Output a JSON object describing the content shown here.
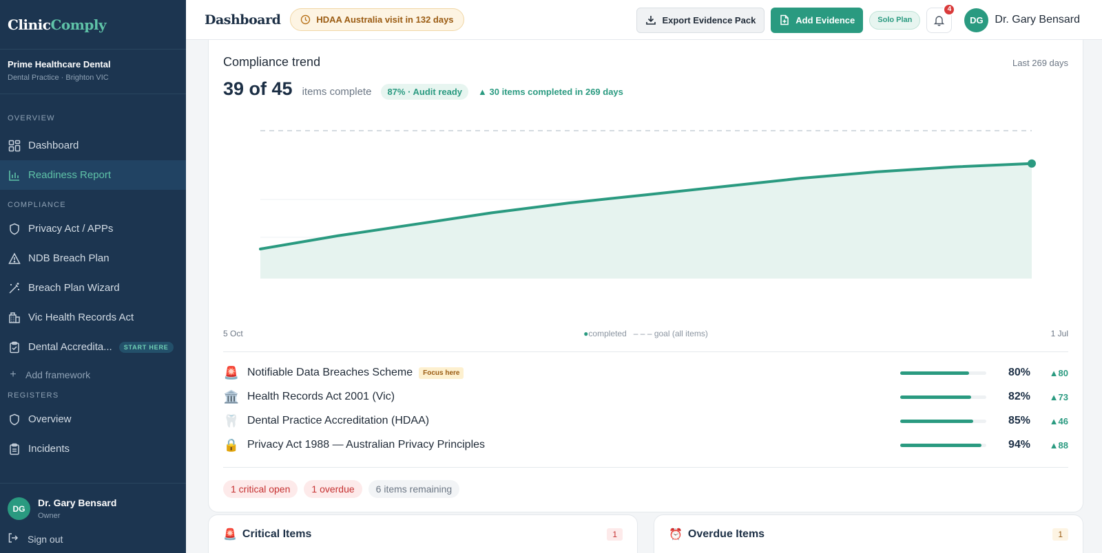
{
  "brand": {
    "part1": "Clinic",
    "part2": "Comply"
  },
  "practice": {
    "name": "Prime Healthcare Dental",
    "sub": "Dental Practice · Brighton VIC"
  },
  "sidebar": {
    "overview_label": "OVERVIEW",
    "compliance_label": "COMPLIANCE",
    "registers_label": "REGISTERS",
    "overview_items": [
      {
        "label": "Dashboard",
        "icon": "grid-icon"
      },
      {
        "label": "Readiness Report",
        "icon": "bar-chart-icon"
      }
    ],
    "compliance_items": [
      {
        "label": "Privacy Act / APPs",
        "icon": "shield-icon"
      },
      {
        "label": "NDB Breach Plan",
        "icon": "warning-icon"
      },
      {
        "label": "Breach Plan Wizard",
        "icon": "wand-icon"
      },
      {
        "label": "Vic Health Records Act",
        "icon": "building-icon"
      },
      {
        "label": "Dental Accredita...",
        "icon": "clipboard-check-icon",
        "tag": "START HERE"
      }
    ],
    "add_framework": "Add framework",
    "register_items": [
      {
        "label": "Overview",
        "icon": "shield-icon"
      },
      {
        "label": "Incidents",
        "icon": "clipboard-icon"
      }
    ]
  },
  "user": {
    "initials": "DG",
    "name": "Dr. Gary Bensard",
    "role": "Owner",
    "signout": "Sign out"
  },
  "topbar": {
    "title": "Dashboard",
    "visit": "HDAA Australia visit in 132 days",
    "export": "Export Evidence Pack",
    "add": "Add Evidence",
    "plan": "Solo Plan",
    "notifications": "4",
    "user_initials": "DG",
    "user_name": "Dr. Gary Bensard"
  },
  "trend": {
    "title": "Compliance trend",
    "period": "Last 269 days",
    "big": "39 of 45",
    "sub": "items complete",
    "ready": "87% · Audit ready",
    "delta": "▲ 30 items completed in 269 days",
    "axis_start": "5 Oct",
    "axis_end": "1 Jul",
    "legend_completed": "completed",
    "legend_goal": "– – – goal (all items)"
  },
  "chart_data": {
    "type": "area",
    "x": [
      "5 Oct",
      "",
      "",
      "",
      "",
      "",
      "",
      "",
      "",
      "",
      "1 Jul"
    ],
    "series": [
      {
        "name": "completed",
        "values": [
          9,
          13,
          16.5,
          20,
          23,
          25.5,
          28,
          30.5,
          32.5,
          34,
          35
        ]
      }
    ],
    "goal": 45,
    "ylim": [
      0,
      45
    ],
    "colors": {
      "line": "#2a9a80",
      "fill": "#e6f3ef",
      "goal": "#d4dae0"
    }
  },
  "frameworks": [
    {
      "emoji": "🚨",
      "name": "Notifiable Data Breaches Scheme",
      "focus": "Focus here",
      "pct": "80%",
      "value": 0.8,
      "delta": "▲80"
    },
    {
      "emoji": "🏛️",
      "name": "Health Records Act 2001 (Vic)",
      "focus": "",
      "pct": "82%",
      "value": 0.82,
      "delta": "▲73"
    },
    {
      "emoji": "🦷",
      "name": "Dental Practice Accreditation (HDAA)",
      "focus": "",
      "pct": "85%",
      "value": 0.85,
      "delta": "▲46"
    },
    {
      "emoji": "🔒",
      "name": "Privacy Act 1988 — Australian Privacy Principles",
      "focus": "",
      "pct": "94%",
      "value": 0.94,
      "delta": "▲88"
    }
  ],
  "chips": {
    "critical": "1 critical open",
    "overdue": "1 overdue",
    "remaining": "6 items remaining"
  },
  "bottom": {
    "critical": {
      "emoji": "🚨",
      "title": "Critical Items",
      "count": "1"
    },
    "overdue": {
      "emoji": "⏰",
      "title": "Overdue Items",
      "count": "1"
    }
  }
}
